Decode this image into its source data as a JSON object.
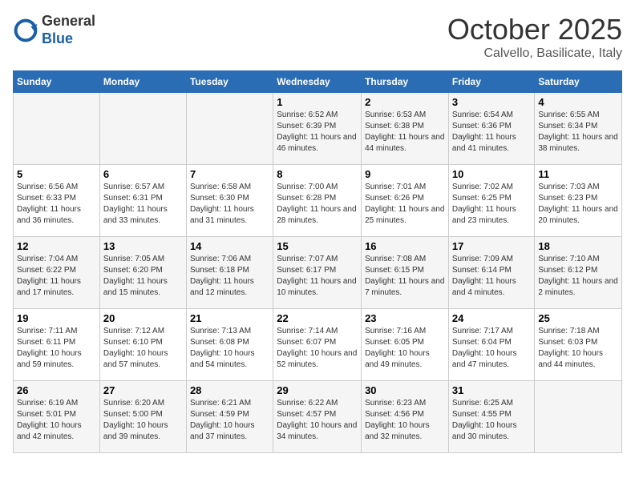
{
  "header": {
    "logo_general": "General",
    "logo_blue": "Blue",
    "month_title": "October 2025",
    "subtitle": "Calvello, Basilicate, Italy"
  },
  "weekdays": [
    "Sunday",
    "Monday",
    "Tuesday",
    "Wednesday",
    "Thursday",
    "Friday",
    "Saturday"
  ],
  "weeks": [
    [
      {
        "day": "",
        "info": ""
      },
      {
        "day": "",
        "info": ""
      },
      {
        "day": "",
        "info": ""
      },
      {
        "day": "1",
        "info": "Sunrise: 6:52 AM\nSunset: 6:39 PM\nDaylight: 11 hours and 46 minutes."
      },
      {
        "day": "2",
        "info": "Sunrise: 6:53 AM\nSunset: 6:38 PM\nDaylight: 11 hours and 44 minutes."
      },
      {
        "day": "3",
        "info": "Sunrise: 6:54 AM\nSunset: 6:36 PM\nDaylight: 11 hours and 41 minutes."
      },
      {
        "day": "4",
        "info": "Sunrise: 6:55 AM\nSunset: 6:34 PM\nDaylight: 11 hours and 38 minutes."
      }
    ],
    [
      {
        "day": "5",
        "info": "Sunrise: 6:56 AM\nSunset: 6:33 PM\nDaylight: 11 hours and 36 minutes."
      },
      {
        "day": "6",
        "info": "Sunrise: 6:57 AM\nSunset: 6:31 PM\nDaylight: 11 hours and 33 minutes."
      },
      {
        "day": "7",
        "info": "Sunrise: 6:58 AM\nSunset: 6:30 PM\nDaylight: 11 hours and 31 minutes."
      },
      {
        "day": "8",
        "info": "Sunrise: 7:00 AM\nSunset: 6:28 PM\nDaylight: 11 hours and 28 minutes."
      },
      {
        "day": "9",
        "info": "Sunrise: 7:01 AM\nSunset: 6:26 PM\nDaylight: 11 hours and 25 minutes."
      },
      {
        "day": "10",
        "info": "Sunrise: 7:02 AM\nSunset: 6:25 PM\nDaylight: 11 hours and 23 minutes."
      },
      {
        "day": "11",
        "info": "Sunrise: 7:03 AM\nSunset: 6:23 PM\nDaylight: 11 hours and 20 minutes."
      }
    ],
    [
      {
        "day": "12",
        "info": "Sunrise: 7:04 AM\nSunset: 6:22 PM\nDaylight: 11 hours and 17 minutes."
      },
      {
        "day": "13",
        "info": "Sunrise: 7:05 AM\nSunset: 6:20 PM\nDaylight: 11 hours and 15 minutes."
      },
      {
        "day": "14",
        "info": "Sunrise: 7:06 AM\nSunset: 6:18 PM\nDaylight: 11 hours and 12 minutes."
      },
      {
        "day": "15",
        "info": "Sunrise: 7:07 AM\nSunset: 6:17 PM\nDaylight: 11 hours and 10 minutes."
      },
      {
        "day": "16",
        "info": "Sunrise: 7:08 AM\nSunset: 6:15 PM\nDaylight: 11 hours and 7 minutes."
      },
      {
        "day": "17",
        "info": "Sunrise: 7:09 AM\nSunset: 6:14 PM\nDaylight: 11 hours and 4 minutes."
      },
      {
        "day": "18",
        "info": "Sunrise: 7:10 AM\nSunset: 6:12 PM\nDaylight: 11 hours and 2 minutes."
      }
    ],
    [
      {
        "day": "19",
        "info": "Sunrise: 7:11 AM\nSunset: 6:11 PM\nDaylight: 10 hours and 59 minutes."
      },
      {
        "day": "20",
        "info": "Sunrise: 7:12 AM\nSunset: 6:10 PM\nDaylight: 10 hours and 57 minutes."
      },
      {
        "day": "21",
        "info": "Sunrise: 7:13 AM\nSunset: 6:08 PM\nDaylight: 10 hours and 54 minutes."
      },
      {
        "day": "22",
        "info": "Sunrise: 7:14 AM\nSunset: 6:07 PM\nDaylight: 10 hours and 52 minutes."
      },
      {
        "day": "23",
        "info": "Sunrise: 7:16 AM\nSunset: 6:05 PM\nDaylight: 10 hours and 49 minutes."
      },
      {
        "day": "24",
        "info": "Sunrise: 7:17 AM\nSunset: 6:04 PM\nDaylight: 10 hours and 47 minutes."
      },
      {
        "day": "25",
        "info": "Sunrise: 7:18 AM\nSunset: 6:03 PM\nDaylight: 10 hours and 44 minutes."
      }
    ],
    [
      {
        "day": "26",
        "info": "Sunrise: 6:19 AM\nSunset: 5:01 PM\nDaylight: 10 hours and 42 minutes."
      },
      {
        "day": "27",
        "info": "Sunrise: 6:20 AM\nSunset: 5:00 PM\nDaylight: 10 hours and 39 minutes."
      },
      {
        "day": "28",
        "info": "Sunrise: 6:21 AM\nSunset: 4:59 PM\nDaylight: 10 hours and 37 minutes."
      },
      {
        "day": "29",
        "info": "Sunrise: 6:22 AM\nSunset: 4:57 PM\nDaylight: 10 hours and 34 minutes."
      },
      {
        "day": "30",
        "info": "Sunrise: 6:23 AM\nSunset: 4:56 PM\nDaylight: 10 hours and 32 minutes."
      },
      {
        "day": "31",
        "info": "Sunrise: 6:25 AM\nSunset: 4:55 PM\nDaylight: 10 hours and 30 minutes."
      },
      {
        "day": "",
        "info": ""
      }
    ]
  ]
}
